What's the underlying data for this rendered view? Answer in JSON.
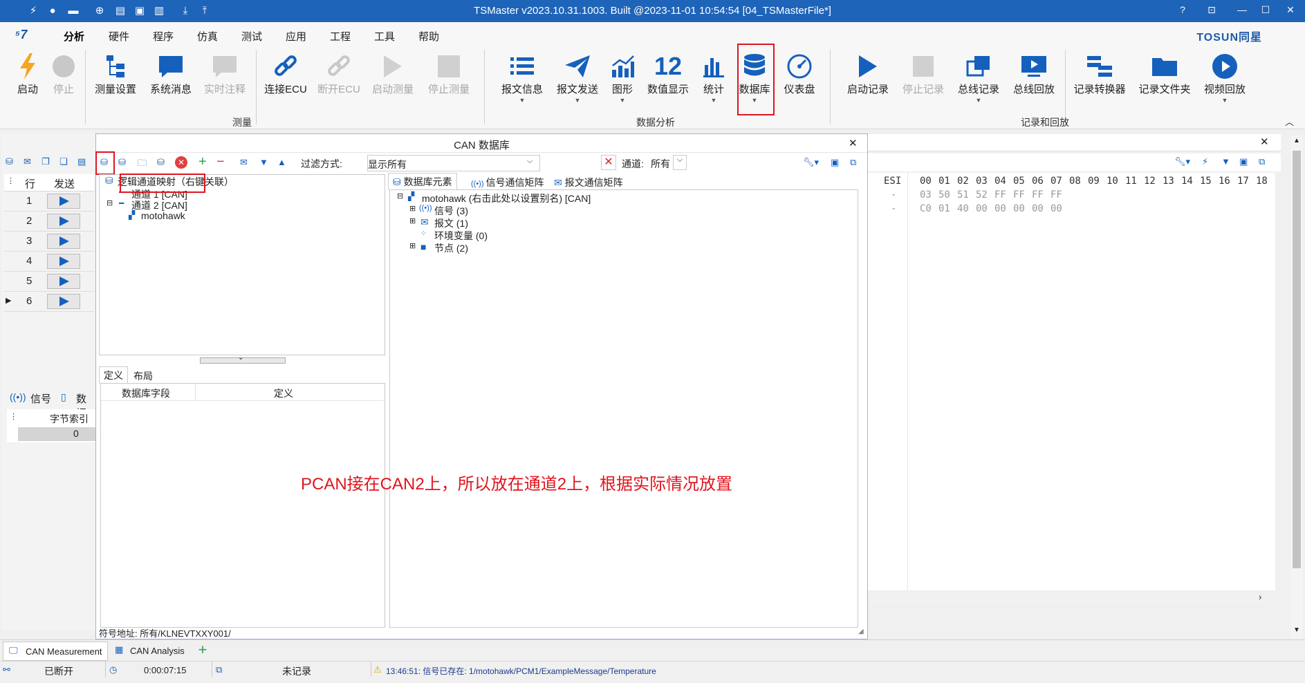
{
  "window": {
    "title": "TSMaster v2023.10.31.1003. Built @2023-11-01 10:54:54 [04_TSMasterFile*]",
    "help": "?",
    "controls": [
      "⊡",
      "—",
      "☐",
      "✕"
    ]
  },
  "brand": "TOSUN同星",
  "menu": [
    "分析",
    "硬件",
    "程序",
    "仿真",
    "测试",
    "应用",
    "工程",
    "工具",
    "帮助"
  ],
  "ribbon": {
    "groups": [
      "测量",
      "数据分析",
      "记录和回放"
    ],
    "buttons": {
      "start": "启动",
      "stop": "停止",
      "measure_setup": "测量设置",
      "sys_msg": "系统消息",
      "realtime_comment": "实时注释",
      "connect_ecu": "连接ECU",
      "disconnect_ecu": "断开ECU",
      "start_measure": "启动测量",
      "stop_measure": "停止测量",
      "msg_info": "报文信息",
      "msg_send": "报文发送",
      "graph": "图形",
      "num_display_icon": "12",
      "num_display": "数值显示",
      "stats": "统计",
      "database": "数据库",
      "dashboard": "仪表盘",
      "start_log": "启动记录",
      "stop_log": "停止记录",
      "bus_log": "总线记录",
      "bus_replay": "总线回放",
      "log_converter": "记录转换器",
      "log_folder": "记录文件夹",
      "video_replay": "视频回放"
    }
  },
  "db_window": {
    "title": "CAN 数据库",
    "filter_label": "过滤方式:",
    "filter_value": "显示所有",
    "channel_label": "通道:",
    "channel_value": "所有",
    "left_tree": {
      "root": "逻辑通道映射（右键关联）",
      "ch1": "通道 1 [CAN]",
      "ch2": "通道 2 [CAN]",
      "db": "motohawk"
    },
    "bottom_tabs": [
      "定义",
      "布局"
    ],
    "def_table": {
      "col1": "数据库字段",
      "col2": "定义"
    },
    "right_tabs": [
      "数据库元素",
      "信号通信矩阵",
      "报文通信矩阵"
    ],
    "right_tree": {
      "root": "motohawk (右击此处以设置别名) [CAN]",
      "signals": "信号 (3)",
      "messages": "报文 (1)",
      "env": "环境变量 (0)",
      "nodes": "节点 (2)"
    },
    "annotation": "PCAN接在CAN2上，所以放在通道2上，根据实际情况放置",
    "symbol_address": "符号地址: 所有/KLNEVTXXY001/"
  },
  "left_panel": {
    "col_row": "行",
    "col_send": "发送",
    "rows": [
      "1",
      "2",
      "3",
      "4",
      "5",
      "6"
    ],
    "tabs": [
      "信号",
      "数据"
    ],
    "byte_index_label": "字节索引",
    "byte_index_value": "0"
  },
  "trace": {
    "header": [
      "ESI",
      "00",
      "01",
      "02",
      "03",
      "04",
      "05",
      "06",
      "07",
      "08",
      "09",
      "10",
      "11",
      "12",
      "13",
      "14",
      "15",
      "16",
      "17",
      "18"
    ],
    "rows": [
      {
        "esi": "-",
        "bytes": [
          "03",
          "50",
          "51",
          "52",
          "FF",
          "FF",
          "FF",
          "FF"
        ]
      },
      {
        "esi": "-",
        "bytes": [
          "C0",
          "01",
          "40",
          "00",
          "00",
          "00",
          "00",
          "00"
        ]
      }
    ]
  },
  "bottom_tabs": [
    "CAN Measurement",
    "CAN Analysis"
  ],
  "status": {
    "conn": "已断开",
    "time": "0:00:07:15",
    "record": "未记录",
    "message": "13:46:51: 信号已存在: 1/motohawk/PCM1/ExampleMessage/Temperature"
  },
  "colors": {
    "title_bar": "#1e64b9",
    "accent": "#1560bd",
    "highlight": "#e0141e",
    "annotation": "#e0141e"
  }
}
